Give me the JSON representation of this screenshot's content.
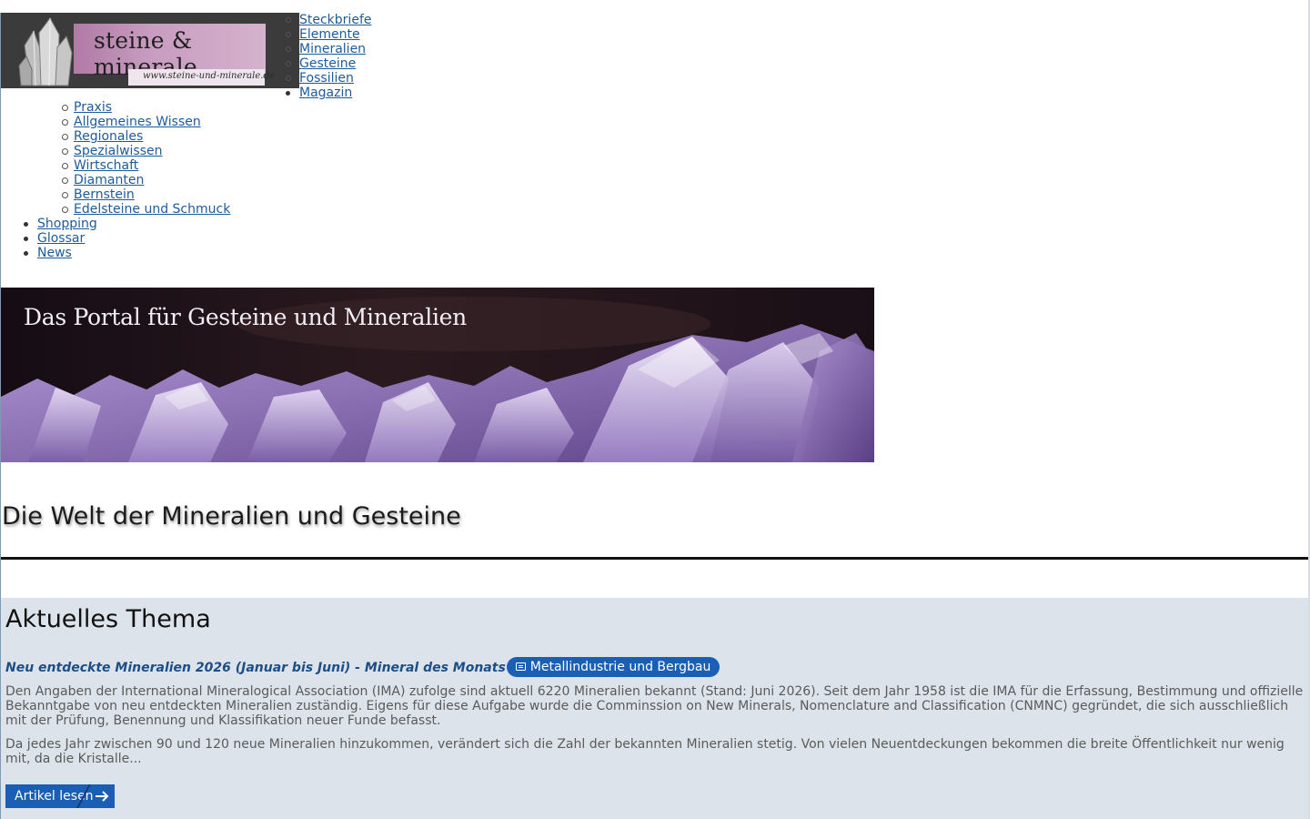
{
  "logo": {
    "title": "steine & minerale",
    "url": "www.steine-und-minerale.de"
  },
  "top_menu": [
    {
      "label": "Steckbriefe",
      "marker": "circle"
    },
    {
      "label": "Elemente",
      "marker": "circle"
    },
    {
      "label": "Mineralien",
      "marker": "circle"
    },
    {
      "label": "Gesteine",
      "marker": "circle"
    },
    {
      "label": "Fossilien",
      "marker": "circle"
    },
    {
      "label": "Magazin",
      "marker": "disc"
    }
  ],
  "magazin_submenu": [
    "Praxis",
    "Allgemeines Wissen",
    "Regionales",
    "Spezialwissen",
    "Wirtschaft",
    "Diamanten",
    "Bernstein",
    "Edelsteine und Schmuck"
  ],
  "main_menu": [
    "Shopping",
    "Glossar",
    "News"
  ],
  "banner": {
    "text": "Das Portal für Gesteine und Mineralien"
  },
  "main_heading": "Die Welt der Mineralien und Gesteine",
  "topic": {
    "section_title": "Aktuelles Thema",
    "article_title": "Neu entdeckte Mineralien 2026 (Januar bis Juni) - Mineral des Monats",
    "category_icon": "newspaper-icon",
    "category": "Metallindustrie und Bergbau",
    "paragraph_1": "Den Angaben der International Mineralogical Association (IMA) zufolge sind aktuell 6220 Mineralien bekannt (Stand: Juni 2026). Seit dem Jahr 1958 ist die IMA für die Erfassung, Bestimmung und offizielle Bekanntgabe von neu entdeckten Mineralien zuständig. Eigens für diese Aufgabe wurde die Comminssion on New Minerals, Nomenclature and Classification (CNMNC) gegründet, die sich ausschließlich mit der Prüfung, Benennung und Klassifikation neuer Funde befasst.",
    "paragraph_2": "Da jedes Jahr zwischen 90 und 120 neue Mineralien hinzukommen, verändert sich die Zahl der bekannten Mineralien stetig. Von vielen Neuentdeckungen bekommen die breite Öffentlichkeit nur wenig mit, da die Kristalle...",
    "read_more_label": "Artikel lesen",
    "read_more_icon": "arrow-right-icon"
  },
  "colors": {
    "link": "#1d5b9a",
    "accent": "#1a5fb4",
    "panel_background": "#dde3ea"
  }
}
